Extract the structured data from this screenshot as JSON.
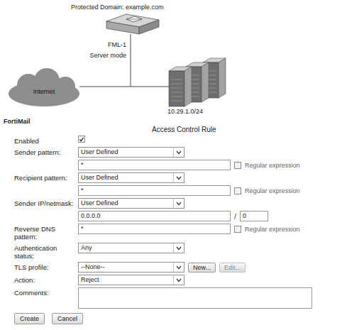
{
  "diagram": {
    "title": "Protected Domain: example.com",
    "device": {
      "name": "FML-1",
      "mode": "Server mode"
    },
    "cloud": "Internet",
    "network": "10.29.1.0/24"
  },
  "section": "FortiMail",
  "form": {
    "title": "Access Control Rule",
    "fields": [
      {
        "kind": "checkbox",
        "label": "Enabled",
        "checked": true
      },
      {
        "kind": "pattern",
        "label": "Sender pattern:",
        "select": "User Defined",
        "value": "*",
        "regex": {
          "label": "Regular expression",
          "checked": false
        }
      },
      {
        "kind": "pattern",
        "label": "Recipient pattern:",
        "select": "User Defined",
        "value": "*",
        "regex": {
          "label": "Regular expression",
          "checked": false
        }
      },
      {
        "kind": "ip",
        "label": "Sender IP/netmask:",
        "select": "User Defined",
        "ip": "0.0.0.0",
        "separator": "/",
        "mask": "0"
      },
      {
        "kind": "text-regex",
        "label": "Reverse DNS pattern:",
        "value": "*",
        "regex": {
          "label": "Regular expression",
          "checked": false
        }
      },
      {
        "kind": "select",
        "label": "Authentication status:",
        "select": "Any"
      },
      {
        "kind": "select-buttons",
        "label": "TLS profile:",
        "select": "--None--",
        "buttons": [
          {
            "label": "New...",
            "disabled": false
          },
          {
            "label": "Edit...",
            "disabled": true
          }
        ]
      },
      {
        "kind": "select",
        "label": "Action:",
        "select": "Reject"
      },
      {
        "kind": "textarea",
        "label": "Comments:",
        "value": ""
      }
    ],
    "buttons": [
      {
        "label": "Create"
      },
      {
        "label": "Cancel"
      }
    ]
  }
}
